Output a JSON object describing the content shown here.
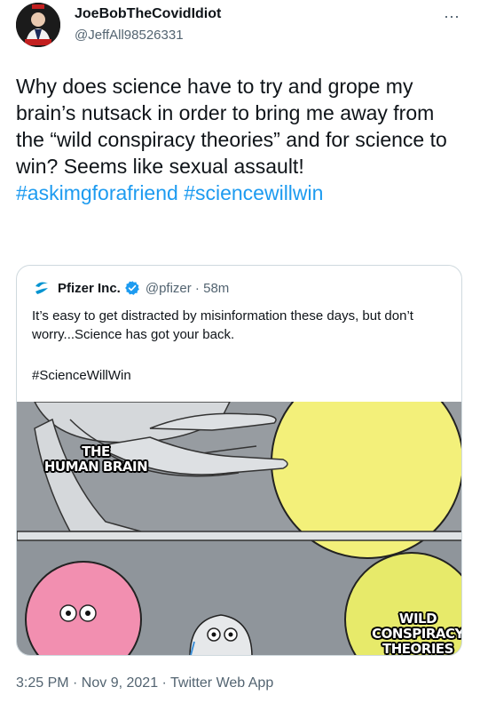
{
  "tweet": {
    "display_name": "JoeBobTheCovidIdiot",
    "handle": "@JeffAll98526331",
    "more_icon": "⋯",
    "text": "Why does science have to try and grope my brain’s nutsack in order to bring me away from the “wild conspiracy theories” and for science to win? Seems like sexual assault!",
    "hashtags": "#askimgforafriend #sciencewillwin",
    "timestamp": "3:25 PM · Nov 9, 2021 · Twitter Web App"
  },
  "quote": {
    "name": "Pfizer Inc.",
    "handle_time": "@pfizer · 58m",
    "text": "It’s easy to get distracted by misinformation these days, but don’t worry...Science has got your back.",
    "hashtag": "#ScienceWillWin",
    "meme": {
      "label_top": "THE\nHUMAN BRAIN",
      "label_bottom": "WILD\nCONSPIRACY\nTHEORIES"
    }
  },
  "colors": {
    "link_blue": "#1d9bf0",
    "verified_blue": "#1d9bf0",
    "pfizer_blue": "#0093d0",
    "muted_gray": "#536471"
  },
  "icons": {
    "avatar": "avatar-image",
    "verified": "verified-badge-icon",
    "pfizer_logo": "pfizer-logo-icon",
    "more": "more-options-icon"
  }
}
